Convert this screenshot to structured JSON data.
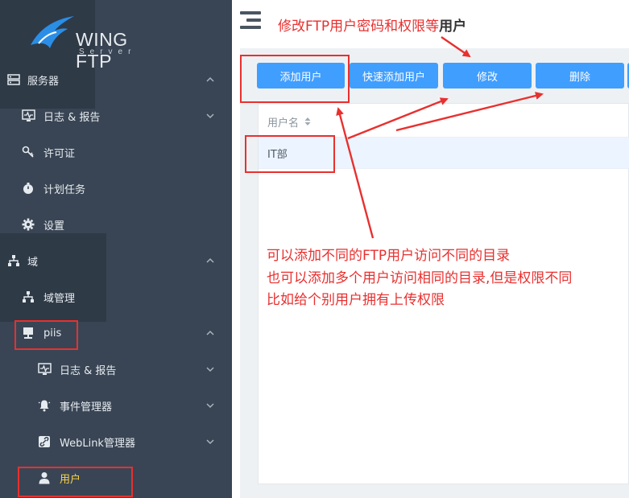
{
  "logo": {
    "name": "WING FTP",
    "sub": "Server"
  },
  "sidebar": {
    "items": [
      {
        "label": "服务器",
        "icon": "server-icon",
        "chevron": "up"
      },
      {
        "label": "日志 & 报告",
        "icon": "monitor-chart-icon",
        "chevron": "down"
      },
      {
        "label": "许可证",
        "icon": "key-icon",
        "chevron": ""
      },
      {
        "label": "计划任务",
        "icon": "stopwatch-icon",
        "chevron": ""
      },
      {
        "label": "设置",
        "icon": "gear-icon",
        "chevron": ""
      },
      {
        "label": "域",
        "icon": "sitemap-icon",
        "chevron": "up"
      },
      {
        "label": "域管理",
        "icon": "sitemap-icon",
        "chevron": ""
      },
      {
        "label": "piis",
        "icon": "desktop-icon",
        "chevron": "up"
      },
      {
        "label": "日志 & 报告",
        "icon": "monitor-chart-icon",
        "chevron": "down"
      },
      {
        "label": "事件管理器",
        "icon": "bell-icon",
        "chevron": "down"
      },
      {
        "label": "WebLink管理器",
        "icon": "link-icon",
        "chevron": "down"
      },
      {
        "label": "用户",
        "icon": "user-icon",
        "chevron": "",
        "active": true
      }
    ]
  },
  "toolbar": {
    "add_user": "添加用户",
    "quick_add_user": "快速添加用户",
    "modify": "修改",
    "delete": "删除"
  },
  "table": {
    "header": "用户名",
    "rows": [
      "IT部"
    ]
  },
  "annotations": {
    "top_red": "修改FTP用户密码和权限等",
    "top_dark": "用户",
    "line1": "可以添加不同的FTP用户访问不同的目录",
    "line2": "也可以添加多个用户访问相同的目录,但是权限不同",
    "line3": "比如给个别用户拥有上传权限"
  },
  "colors": {
    "sidebar_bg": "#394554",
    "button": "#409eff",
    "annotation": "#e8302f",
    "active_label": "#ffd44a",
    "selected_row": "#ecf5ff"
  }
}
